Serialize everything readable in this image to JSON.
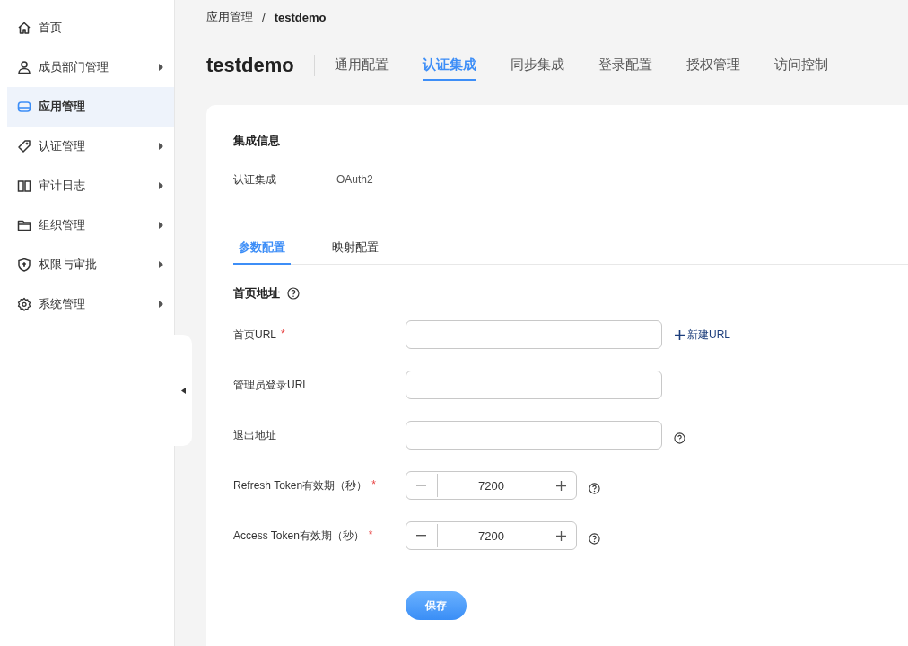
{
  "sidebar": {
    "items": [
      {
        "label": "首页",
        "selected": false,
        "expandable": false
      },
      {
        "label": "成员部门管理",
        "selected": false,
        "expandable": true
      },
      {
        "label": "应用管理",
        "selected": true,
        "expandable": false
      },
      {
        "label": "认证管理",
        "selected": false,
        "expandable": true
      },
      {
        "label": "审计日志",
        "selected": false,
        "expandable": true
      },
      {
        "label": "组织管理",
        "selected": false,
        "expandable": true
      },
      {
        "label": "权限与审批",
        "selected": false,
        "expandable": true
      },
      {
        "label": "系统管理",
        "selected": false,
        "expandable": true
      }
    ]
  },
  "breadcrumb": {
    "items": [
      {
        "label": "应用管理",
        "current": false
      },
      {
        "label": "testdemo",
        "current": true
      }
    ],
    "separator": "/"
  },
  "header": {
    "title": "testdemo",
    "tabs": [
      {
        "label": "通用配置",
        "selected": false
      },
      {
        "label": "认证集成",
        "selected": true
      },
      {
        "label": "同步集成",
        "selected": false
      },
      {
        "label": "登录配置",
        "selected": false
      },
      {
        "label": "授权管理",
        "selected": false
      },
      {
        "label": "访问控制",
        "selected": false
      }
    ]
  },
  "info": {
    "title": "集成信息",
    "rows": [
      {
        "label": "认证集成",
        "value": "OAuth2"
      }
    ]
  },
  "subtabs": [
    {
      "label": "参数配置",
      "selected": true
    },
    {
      "label": "映射配置",
      "selected": false
    }
  ],
  "section": {
    "title": "首页地址",
    "help": true
  },
  "fields": [
    {
      "kind": "text",
      "label": "首页URL",
      "required_mark": "*",
      "help": false,
      "action": "新建URL"
    },
    {
      "kind": "text",
      "label": "管理员登录URL",
      "help": false
    },
    {
      "kind": "text",
      "label": "退出地址",
      "help": true
    },
    {
      "kind": "number",
      "label": "Refresh Token有效期（秒）",
      "required_mark": "*",
      "help": true,
      "value": "7200"
    },
    {
      "kind": "number",
      "label": "Access Token有效期（秒）",
      "required_mark": "*",
      "help": true,
      "value": "7200"
    }
  ],
  "save_button": "保存"
}
